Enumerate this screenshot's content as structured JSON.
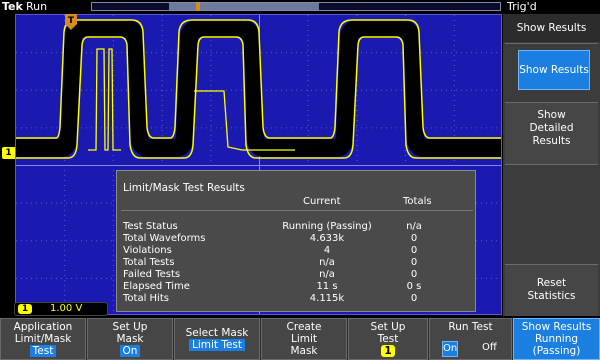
{
  "topbar": {
    "brand": "Tek",
    "run_state": "Run",
    "trigger_status": "Trig'd"
  },
  "waveform": {
    "channel": "1",
    "trigger_marker": "T",
    "trace_color": "#ffff00",
    "mask_color": "#000000",
    "graticule_color": "#1a1ab0"
  },
  "results": {
    "title": "Limit/Mask Test Results",
    "col_current": "Current",
    "col_totals": "Totals",
    "rows": [
      {
        "label": "Test Status",
        "current": "Running (Passing)",
        "totals": "n/a"
      },
      {
        "label": "Total Waveforms",
        "current": "4.633k",
        "totals": "0"
      },
      {
        "label": "Violations",
        "current": "4",
        "totals": "0"
      },
      {
        "label": "Total Tests",
        "current": "n/a",
        "totals": "0"
      },
      {
        "label": "Failed Tests",
        "current": "n/a",
        "totals": "0"
      },
      {
        "label": "Elapsed Time",
        "current": "11 s",
        "totals": "0 s"
      },
      {
        "label": "Total Hits",
        "current": "4.115k",
        "totals": "0"
      }
    ]
  },
  "channel_readout": {
    "chip": "1",
    "scale": "1.00 V"
  },
  "side_menu": {
    "title": "Show Results",
    "show_results": "Show Results",
    "show_detailed_1": "Show",
    "show_detailed_2": "Detailed",
    "show_detailed_3": "Results",
    "reset_1": "Reset",
    "reset_2": "Statistics"
  },
  "bottom_menu": {
    "app_1": "Application",
    "app_2": "Limit/Mask",
    "app_3": "Test",
    "setup_1": "Set Up",
    "setup_2": "Mask",
    "setup_3": "On",
    "select_1": "Select Mask",
    "select_2": "Limit Test",
    "create_1": "Create",
    "create_2": "Limit",
    "create_3": "Mask",
    "setuptest_1": "Set Up",
    "setuptest_2": "Test",
    "setuptest_3": "1",
    "runtest_1": "Run Test",
    "runtest_on": "On",
    "runtest_off": "Off",
    "show_1": "Show Results",
    "show_2": "Running",
    "show_3": "(Passing)"
  }
}
